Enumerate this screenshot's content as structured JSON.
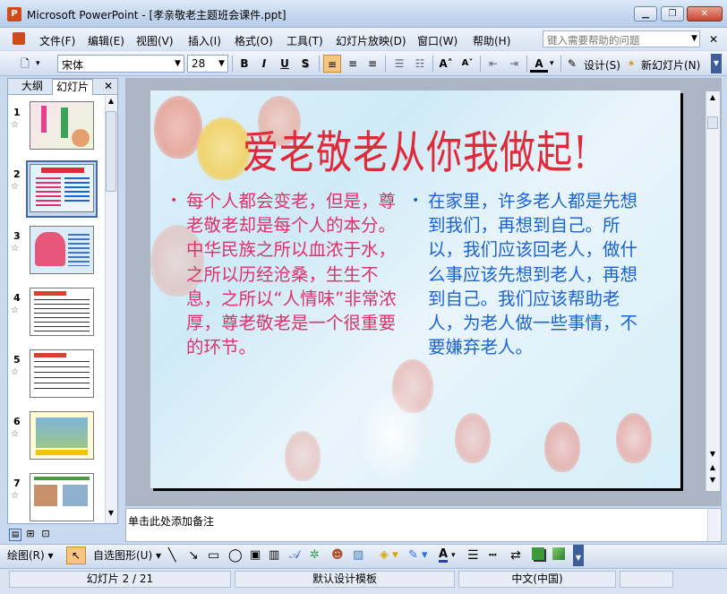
{
  "window": {
    "title": "Microsoft PowerPoint - [孝亲敬老主题班会课件.ppt]",
    "app_badge": "P"
  },
  "menu": {
    "items": [
      "文件(F)",
      "编辑(E)",
      "视图(V)",
      "插入(I)",
      "格式(O)",
      "工具(T)",
      "幻灯片放映(D)",
      "窗口(W)",
      "帮助(H)"
    ],
    "help_placeholder": "键入需要帮助的问题"
  },
  "toolbar": {
    "font_name": "宋体",
    "font_size": "28",
    "bold": "B",
    "italic": "I",
    "underline": "U",
    "shadow": "S",
    "design_label": "设计(S)",
    "new_slide_label": "新幻灯片(N)"
  },
  "panel": {
    "tabs": [
      "大纲",
      "幻灯片"
    ],
    "close": "✕",
    "thumbnails": [
      "1",
      "2",
      "3",
      "4",
      "5",
      "6",
      "7"
    ],
    "selected": 2
  },
  "slide": {
    "title": "爱老敬老从你我做起!",
    "left_text": "每个人都会变老，但是，尊老敬老却是每个人的本分。中华民族之所以血浓于水，之所以历经沧桑，生生不息，之所以“人情味”非常浓厚，尊老敬老是一个很重要的环节。",
    "right_text": "在家里，许多老人都是先想到我们，再想到自己。所以，我们应该回老人，做什么事应该先想到老人，再想到自己。我们应该帮助老人，为老人做一些事情，不要嫌弃老人。"
  },
  "notes": {
    "placeholder": "单击此处添加备注"
  },
  "drawing": {
    "draw_label": "绘图(R)",
    "autoshape_label": "自选图形(U)"
  },
  "status": {
    "slide_info": "幻灯片 2 / 21",
    "template": "默认设计模板",
    "language": "中文(中国)"
  },
  "colors": {
    "title_red": "#e02a3a",
    "left_pink": "#e0306a",
    "right_blue": "#1b62d4"
  }
}
